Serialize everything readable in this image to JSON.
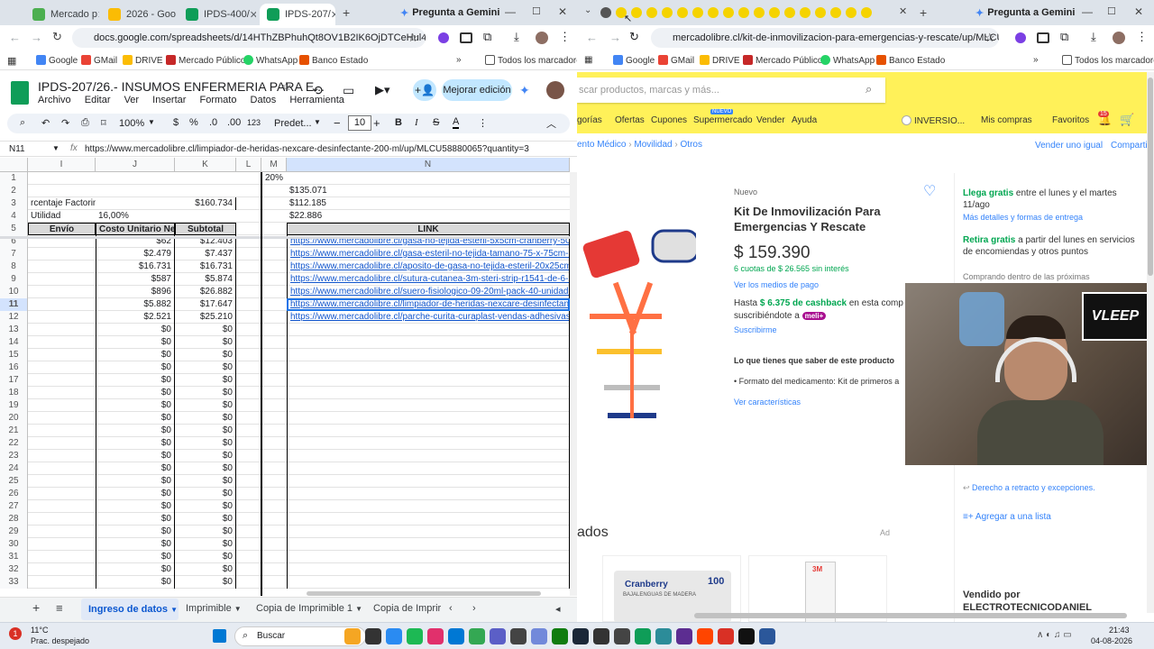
{
  "left_window": {
    "tabs": [
      {
        "label": "Mercado p",
        "color": "#4caf50"
      },
      {
        "label": "2026 - Goo",
        "color": "#fbbc04"
      },
      {
        "label": "IPDS-400/",
        "color": "#0f9d58"
      },
      {
        "label": "IPDS-207/",
        "color": "#0f9d58"
      }
    ],
    "new_tab": "+",
    "gemini": "Pregunta a Gemini",
    "url": "docs.google.com/spreadsheets/d/14HThZBPhuhQt8OV1B2IK6OjDTCeHul46U4ox...",
    "bookmarks": [
      "Google",
      "GMail",
      "DRIVE",
      "Mercado Público",
      "WhatsApp",
      "Banco Estado"
    ],
    "bookmarks_more": "»",
    "all_bookmarks": "Todos los marcadores",
    "doc_title": "IPDS-207/26.- INSUMOS ENFERMERIA PARA E...",
    "menu": [
      "Archivo",
      "Editar",
      "Ver",
      "Insertar",
      "Formato",
      "Datos",
      "Herramienta"
    ],
    "share_button": "Mejorar edición",
    "toolbar": {
      "zoom": "100%",
      "currency": "$",
      "percent": "%",
      "dec_less": ".0",
      "dec_more": ".00",
      "num123": "123",
      "font": "Predet...",
      "font_size": "10",
      "minus": "−",
      "plus": "+",
      "bold": "B",
      "italic": "I",
      "strike": "S",
      "textcolor": "A",
      "more": "⋮"
    },
    "namebox": "N11",
    "formula": "https://www.mercadolibre.cl/limpiador-de-heridas-nexcare-desinfectante-200-ml/up/MLCU58880065?quantity=3",
    "columns": [
      "I",
      "J",
      "K",
      "L",
      "M",
      "N"
    ],
    "rows": [
      {
        "n": "1",
        "i": "",
        "j": "",
        "k": "",
        "m": "20%",
        "n_val": ""
      },
      {
        "n": "2",
        "i": "",
        "j": "",
        "k": "",
        "m": "",
        "n_val": "$135.071"
      },
      {
        "n": "3",
        "i": "rcentaje Factoring:",
        "j": "",
        "k": "$160.734",
        "m": "",
        "n_val": "$112.185"
      },
      {
        "n": "4",
        "i": "Utilidad",
        "j": "16,00%",
        "k": "",
        "m": "",
        "n_val": "$22.886"
      },
      {
        "n": "5",
        "i": "Envío",
        "j": "Costo Unitario Neto",
        "k": "Subtotal",
        "m": "",
        "n_val": "LINK"
      },
      {
        "n": "6",
        "i": "",
        "j": "$62",
        "k": "$12.403",
        "m": "",
        "n_val": "https://www.mercadolibre.cl/gasa-no-tejida-esteril-5x5cm-cranberry-50-sobres-"
      },
      {
        "n": "7",
        "i": "",
        "j": "$2.479",
        "k": "$7.437",
        "m": "",
        "n_val": "https://www.mercadolibre.cl/gasa-esteril-no-tejida-tamano-75-x-75cm-cranberry"
      },
      {
        "n": "8",
        "i": "",
        "j": "$16.731",
        "k": "$16.731",
        "m": "",
        "n_val": "https://www.mercadolibre.cl/aposito-de-gasa-no-tejida-esteril-20x25cm-24-unds"
      },
      {
        "n": "9",
        "i": "",
        "j": "$587",
        "k": "$5.874",
        "m": "",
        "n_val": "https://www.mercadolibre.cl/sutura-cutanea-3m-steri-strip-r1541-de-6-x-75-mm-"
      },
      {
        "n": "10",
        "i": "",
        "j": "$896",
        "k": "$26.882",
        "m": "",
        "n_val": "https://www.mercadolibre.cl/suero-fisiologico-09-20ml-pack-40-unidades-esteril"
      },
      {
        "n": "11",
        "i": "",
        "j": "$5.882",
        "k": "$17.647",
        "m": "",
        "n_val": "https://www.mercadolibre.cl/limpiador-de-heridas-nexcare-desinfectante-200-m"
      },
      {
        "n": "12",
        "i": "",
        "j": "$2.521",
        "k": "$25.210",
        "m": "",
        "n_val": "https://www.mercadolibre.cl/parche-curita-curaplast-vendas-adhesivas--caja-de"
      },
      {
        "n": "13",
        "j": "$0",
        "k": "$0"
      },
      {
        "n": "14",
        "j": "$0",
        "k": "$0"
      },
      {
        "n": "15",
        "j": "$0",
        "k": "$0"
      },
      {
        "n": "16",
        "j": "$0",
        "k": "$0"
      },
      {
        "n": "17",
        "j": "$0",
        "k": "$0"
      },
      {
        "n": "18",
        "j": "$0",
        "k": "$0"
      },
      {
        "n": "19",
        "j": "$0",
        "k": "$0"
      },
      {
        "n": "20",
        "j": "$0",
        "k": "$0"
      },
      {
        "n": "21",
        "j": "$0",
        "k": "$0"
      },
      {
        "n": "22",
        "j": "$0",
        "k": "$0"
      },
      {
        "n": "23",
        "j": "$0",
        "k": "$0"
      },
      {
        "n": "24",
        "j": "$0",
        "k": "$0"
      },
      {
        "n": "25",
        "j": "$0",
        "k": "$0"
      },
      {
        "n": "26",
        "j": "$0",
        "k": "$0"
      },
      {
        "n": "27",
        "j": "$0",
        "k": "$0"
      },
      {
        "n": "28",
        "j": "$0",
        "k": "$0"
      },
      {
        "n": "29",
        "j": "$0",
        "k": "$0"
      },
      {
        "n": "30",
        "j": "$0",
        "k": "$0"
      },
      {
        "n": "31",
        "j": "$0",
        "k": "$0"
      },
      {
        "n": "32",
        "j": "$0",
        "k": "$0"
      },
      {
        "n": "33",
        "j": "$0",
        "k": "$0"
      }
    ],
    "sheet_tabs": [
      "Ingreso de datos",
      "Imprimible",
      "Copia de Imprimible 1",
      "Copia de Imprir"
    ]
  },
  "right_window": {
    "gemini": "Pregunta a Gemini",
    "url": "mercadolibre.cl/kit-de-inmovilizacion-para-emergencias-y-rescate/up/MLCU417...",
    "bookmarks": [
      "Google",
      "GMail",
      "DRIVE",
      "Mercado Público",
      "WhatsApp",
      "Banco Estado"
    ],
    "all_bookmarks": "Todos los marcadores",
    "search_placeholder": "scar productos, marcas y más...",
    "nav": [
      "gorías",
      "Ofertas",
      "Cupones",
      "Supermercado",
      "Vender",
      "Ayuda"
    ],
    "nav_new_badge": "NUEVO",
    "account": "INVERSIO...",
    "my_purchases": "Mis compras",
    "favorites": "Favoritos",
    "cart_count": "15",
    "breadcrumb": [
      "ento Médico",
      "Movilidad",
      "Otros"
    ],
    "sell_same": "Vender uno igual",
    "share": "Comparti",
    "condition": "Nuevo",
    "title": "Kit De Inmovilización Para Emergencias Y Rescate",
    "price": "$ 159.390",
    "installments": "6 cuotas de $ 26.565 sin interés",
    "payment_link": "Ver los medios de pago",
    "cashback_prefix": "Hasta",
    "cashback_amount": "$ 6.375 de cashback",
    "cashback_suffix": "en esta comp",
    "cashback_line2": "suscribiéndote a",
    "meli_badge": "meli+",
    "subscribe": "Suscribirme",
    "features_title": "Lo que tienes que saber de este producto",
    "feature1": "Formato del medicamento: Kit de primeros a",
    "see_features": "Ver características",
    "shipping_free": "Llega gratis",
    "shipping_text": "entre el lunes y el martes 11/ago",
    "shipping_more": "Más detalles y formas de entrega",
    "pickup_free": "Retira gratis",
    "pickup_text": "a partir del lunes en servicios de encomiendas y otros puntos",
    "pickup_more": "Comprando dentro de las próximas",
    "return_link": "Derecho a retracto y excepciones.",
    "add_list": "Agregar a una lista",
    "related_title": "ados",
    "ad_label": "Ad",
    "related_brand": "Cranberry",
    "related_sub": "BAJALENGUAS DE MADERA",
    "related_count": "100",
    "sold_by": "Vendido por",
    "seller": "ELECTROTECNICODANIEL",
    "webcam_logo": "VLEEP"
  },
  "taskbar": {
    "weather_temp": "11°C",
    "weather_desc": "Prac. despejado",
    "weather_badge": "1",
    "search": "Buscar",
    "time": "21:43",
    "date": "04-08-2026"
  },
  "colors": {
    "ml_yellow": "#fff159",
    "ml_blue": "#3483fa",
    "ml_green": "#00a650",
    "sheets_green": "#0f9d58"
  }
}
